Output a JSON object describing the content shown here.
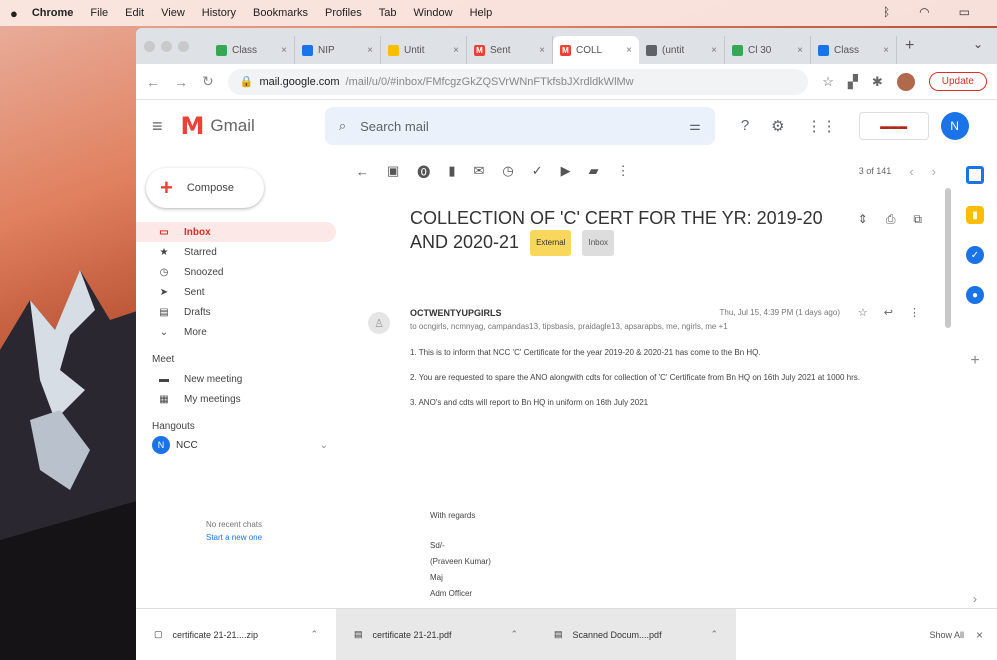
{
  "menubar": {
    "items": [
      "Chrome",
      "File",
      "Edit",
      "View",
      "History",
      "Bookmarks",
      "Profiles",
      "Tab",
      "Window",
      "Help"
    ]
  },
  "tabs": [
    {
      "label": "Class",
      "color": "#34a853"
    },
    {
      "label": "NIP",
      "color": "#1a73e8"
    },
    {
      "label": "Untit",
      "color": "#fbbc04"
    },
    {
      "label": "Sent",
      "color": "#ea4335"
    },
    {
      "label": "COLL",
      "color": "#ea4335"
    },
    {
      "label": "(untit",
      "color": "#5f6368"
    },
    {
      "label": "Cl 30",
      "color": "#34a853"
    },
    {
      "label": "Class",
      "color": "#1a73e8"
    }
  ],
  "omnibar": {
    "host": "mail.google.com",
    "path": "/mail/u/0/#inbox/FMfcgzGkZQSVrWNnFTkfsbJXrdldkWlMw",
    "update_label": "Update"
  },
  "gmail": {
    "brand": "Gmail",
    "search_placeholder": "Search mail",
    "avatar_initial": "N",
    "compose_label": "Compose",
    "nav": [
      "Inbox",
      "Starred",
      "Snoozed",
      "Sent",
      "Drafts",
      "More"
    ],
    "meet_title": "Meet",
    "meet_items": [
      "New meeting",
      "My meetings"
    ],
    "hangouts_title": "Hangouts",
    "hangouts_user": "NCC",
    "no_chats": "No recent chats",
    "start_new": "Start a new one"
  },
  "toolbar": {
    "pager": "3 of 141"
  },
  "email": {
    "subject": "COLLECTION OF 'C' CERT FOR THE YR: 2019-20 AND 2020-21",
    "label_external": "External",
    "label_inbox": "Inbox",
    "sender": "OCTWENTYUPGIRLS",
    "date": "Thu, Jul 15, 4:39 PM (1 days ago)",
    "recipients": "to ocngirls, ncmnyag, campandas13, tipsbasis, praidagle13, apsarapbs, me, ngirls, me +1",
    "paragraphs": [
      "1.   This is to inform that NCC 'C' Certificate for the year 2019-20 & 2020-21  has come to the Bn HQ.",
      "2.   You are requested to spare the ANO alongwith cdts for collection of 'C' Certificate from Bn HQ on 16th July 2021 at 1000 hrs.",
      "3.   ANO's and cdts will report to Bn HQ in uniform on 16th July 2021"
    ],
    "signature": [
      "With regards",
      "Sd/-",
      "(Praveen Kumar)",
      "Maj",
      "Adm Officer"
    ]
  },
  "downloads": [
    {
      "name": "certificate 21-21....zip",
      "icon": "zip-icon"
    },
    {
      "name": "certificate 21-21.pdf",
      "icon": "pdf-icon"
    },
    {
      "name": "Scanned Docum....pdf",
      "icon": "pdf-icon"
    }
  ],
  "show_all": "Show All"
}
